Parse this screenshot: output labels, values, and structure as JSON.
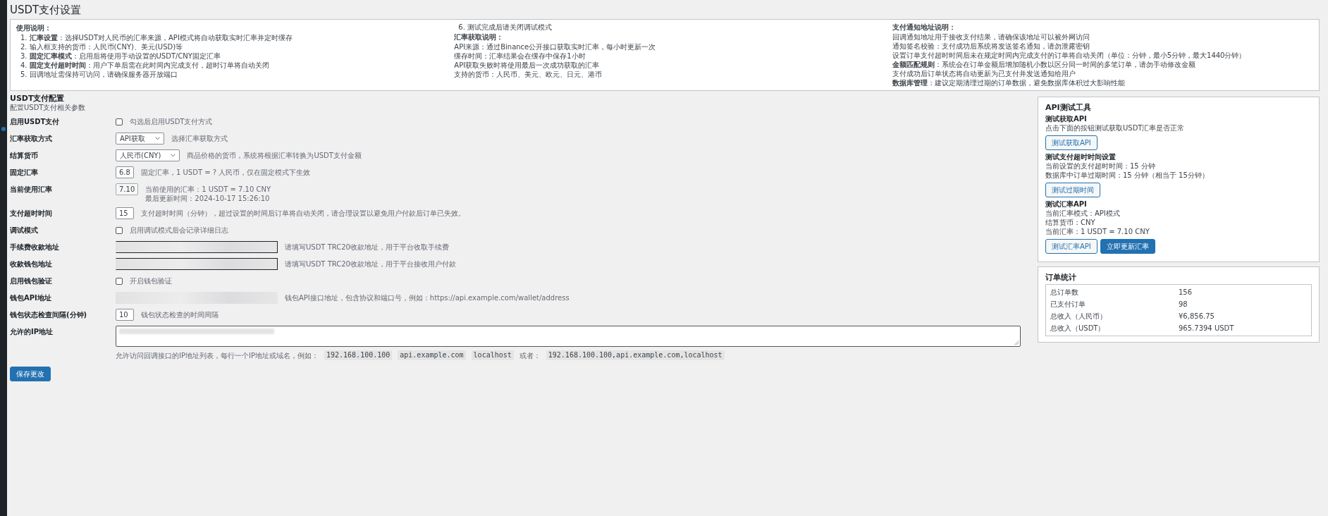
{
  "page_title": "USDT支付设置",
  "notice": [
    {
      "kind": "heading",
      "text": "使用说明："
    },
    {
      "kind": "ordered",
      "items": [
        {
          "number": "1.",
          "text": "**汇率设置**：选择USDT对人民币的汇率来源，API模式将自动获取实时汇率并定时缓存"
        },
        {
          "number": "2.",
          "text": "输入框支持的货币：人民币(CNY)、美元(USD)等"
        },
        {
          "number": "3.",
          "text": "**固定汇率模式**：启用后将使用手动设置的USDT/CNY固定汇率"
        },
        {
          "number": "4.",
          "text": "**固定支付超时时间**：用户下单后需在此时间内完成支付，超时订单将自动关闭"
        },
        {
          "number": "5.",
          "text": "回调地址需保持可访问，请确保服务器开放端口"
        },
        {
          "number": "6.",
          "text": "测试完成后请关闭调试模式"
        }
      ]
    },
    {
      "kind": "heading",
      "text": "汇率获取说明："
    },
    {
      "kind": "line",
      "text": "API来源：通过Binance公开接口获取实时汇率，每小时更新一次"
    },
    {
      "kind": "line",
      "text": "缓存时间：汇率结果会在缓存中保存1小时"
    },
    {
      "kind": "line",
      "text": "API获取失败时将使用最后一次成功获取的汇率"
    },
    {
      "kind": "line",
      "text": "支持的货币：人民币、美元、欧元、日元、港币"
    },
    {
      "kind": "heading",
      "text": "支付通知地址说明："
    },
    {
      "kind": "line",
      "text": "回调通知地址用于接收支付结果，请确保该地址可以被外网访问"
    },
    {
      "kind": "line",
      "text": "通知签名校验：支付成功后系统将发送签名通知，请勿泄露密钥"
    },
    {
      "kind": "line",
      "text": "设置订单支付超时时间后未在规定时间内完成支付的订单将自动关闭（单位：分钟，最小5分钟，最大1440分钟）"
    },
    {
      "kind": "line",
      "text": "**金额匹配规则**：系统会在订单金额后增加随机小数以区分同一时间的多笔订单，请勿手动修改金额"
    },
    {
      "kind": "line",
      "text": "支付成功后订单状态将自动更新为已支付并发送通知给用户"
    },
    {
      "kind": "line",
      "text": "**数据库管理**：建议定期清理过期的订单数据，避免数据库体积过大影响性能"
    }
  ],
  "section": {
    "title": "USDT支付配置",
    "subtitle": "配置USDT支付相关参数"
  },
  "fields": [
    {
      "kind": "checkbox",
      "label": "启用USDT支付",
      "checked": false,
      "description": [
        {
          "kind": "text",
          "text": "勾选后启用USDT支付方式"
        }
      ]
    },
    {
      "kind": "select",
      "label": "汇率获取方式",
      "value": "API获取",
      "description": [
        {
          "kind": "text",
          "text": "选择汇率获取方式"
        }
      ]
    },
    {
      "kind": "select",
      "label": "结算货币",
      "value": "人民币(CNY)",
      "description": [
        {
          "kind": "text",
          "text": "商品价格的货币，系统将根据汇率转换为USDT支付金额"
        }
      ]
    },
    {
      "kind": "text",
      "label": "固定汇率",
      "value": "6.8",
      "readonly": false,
      "description": [
        {
          "kind": "text",
          "text": "固定汇率，1 USDT = ? 人民币，仅在固定模式下生效"
        }
      ]
    },
    {
      "kind": "text",
      "label": "当前使用汇率",
      "value": "7.10",
      "readonly": true,
      "description": [
        {
          "kind": "text",
          "text": "当前使用的汇率：1 USDT = 7.10 CNY"
        },
        {
          "kind": "text",
          "text": "最后更新时间：2024-10-17 15:26:10"
        }
      ]
    },
    {
      "kind": "text",
      "label": "支付超时时间",
      "value": "15",
      "readonly": false,
      "description": [
        {
          "kind": "text",
          "text": "支付超时时间（分钟），超过设置的时间后订单将自动关闭，请合理设置以避免用户付款后订单已失效。"
        }
      ]
    },
    {
      "kind": "checkbox",
      "label": "调试模式",
      "checked": false,
      "description": [
        {
          "kind": "text",
          "text": "启用调试模式后会记录详细日志"
        }
      ]
    },
    {
      "kind": "redacted",
      "label": "手续费收款地址",
      "bordered": true,
      "description": [
        {
          "kind": "text",
          "text": "请填写USDT TRC20收款地址，用于平台收取手续费"
        }
      ]
    },
    {
      "kind": "redacted",
      "label": "收款钱包地址",
      "bordered": true,
      "description": [
        {
          "kind": "text",
          "text": "请填写USDT TRC20收款地址，用于平台接收用户付款"
        }
      ]
    },
    {
      "kind": "checkbox",
      "label": "启用钱包验证",
      "checked": false,
      "description": [
        {
          "kind": "text",
          "text": "开启钱包验证"
        }
      ]
    },
    {
      "kind": "redacted",
      "label": "钱包API地址",
      "bordered": false,
      "description": [
        {
          "kind": "text",
          "text": "钱包API接口地址，包含协议和端口号，例如：https://api.example.com/wallet/address"
        }
      ]
    },
    {
      "kind": "text",
      "label": "钱包状态检查间隔(分钟)",
      "value": "10",
      "readonly": false,
      "description": [
        {
          "kind": "text",
          "text": "钱包状态检查的时间间隔"
        }
      ]
    },
    {
      "kind": "textarea",
      "label": "允许的IP地址",
      "description": [
        {
          "kind": "text",
          "text": "允许访问回调接口的IP地址列表，每行一个IP地址或域名，例如："
        },
        {
          "kind": "code",
          "text": "192.168.100.100"
        },
        {
          "kind": "code",
          "text": "api.example.com"
        },
        {
          "kind": "code",
          "text": "localhost"
        },
        {
          "kind": "mixed",
          "text": "或者：",
          "code": "192.168.100.100,api.example.com,localhost"
        }
      ]
    }
  ],
  "save_button": "保存更改",
  "tools": {
    "title": "API测试工具",
    "groups": [
      {
        "heading": "测试获取API",
        "lines": [
          "点击下面的按钮测试获取USDT汇率是否正常"
        ],
        "buttons": [
          {
            "label": "测试获取API",
            "primary": false
          }
        ]
      },
      {
        "heading": "测试支付超时时间设置",
        "lines": [
          "当前设置的支付超时时间：15 分钟",
          "数据库中订单过期时间：15 分钟（相当于 15分钟）"
        ],
        "buttons": [
          {
            "label": "测试过期时间",
            "primary": false
          }
        ]
      },
      {
        "heading": "测试汇率API",
        "lines": [
          "当前汇率模式：API模式",
          "结算货币：CNY",
          "当前汇率：1 USDT = 7.10 CNY"
        ],
        "buttons": [
          {
            "label": "测试汇率API",
            "primary": false
          },
          {
            "label": "立即更新汇率",
            "primary": true
          }
        ]
      }
    ]
  },
  "stats": {
    "title": "订单统计",
    "rows": [
      {
        "label": "总订单数",
        "value": "156"
      },
      {
        "label": "已支付订单",
        "value": "98"
      },
      {
        "label": "总收入（人民币）",
        "value": "¥6,856.75"
      },
      {
        "label": "总收入（USDT）",
        "value": "965.7394 USDT"
      }
    ]
  }
}
